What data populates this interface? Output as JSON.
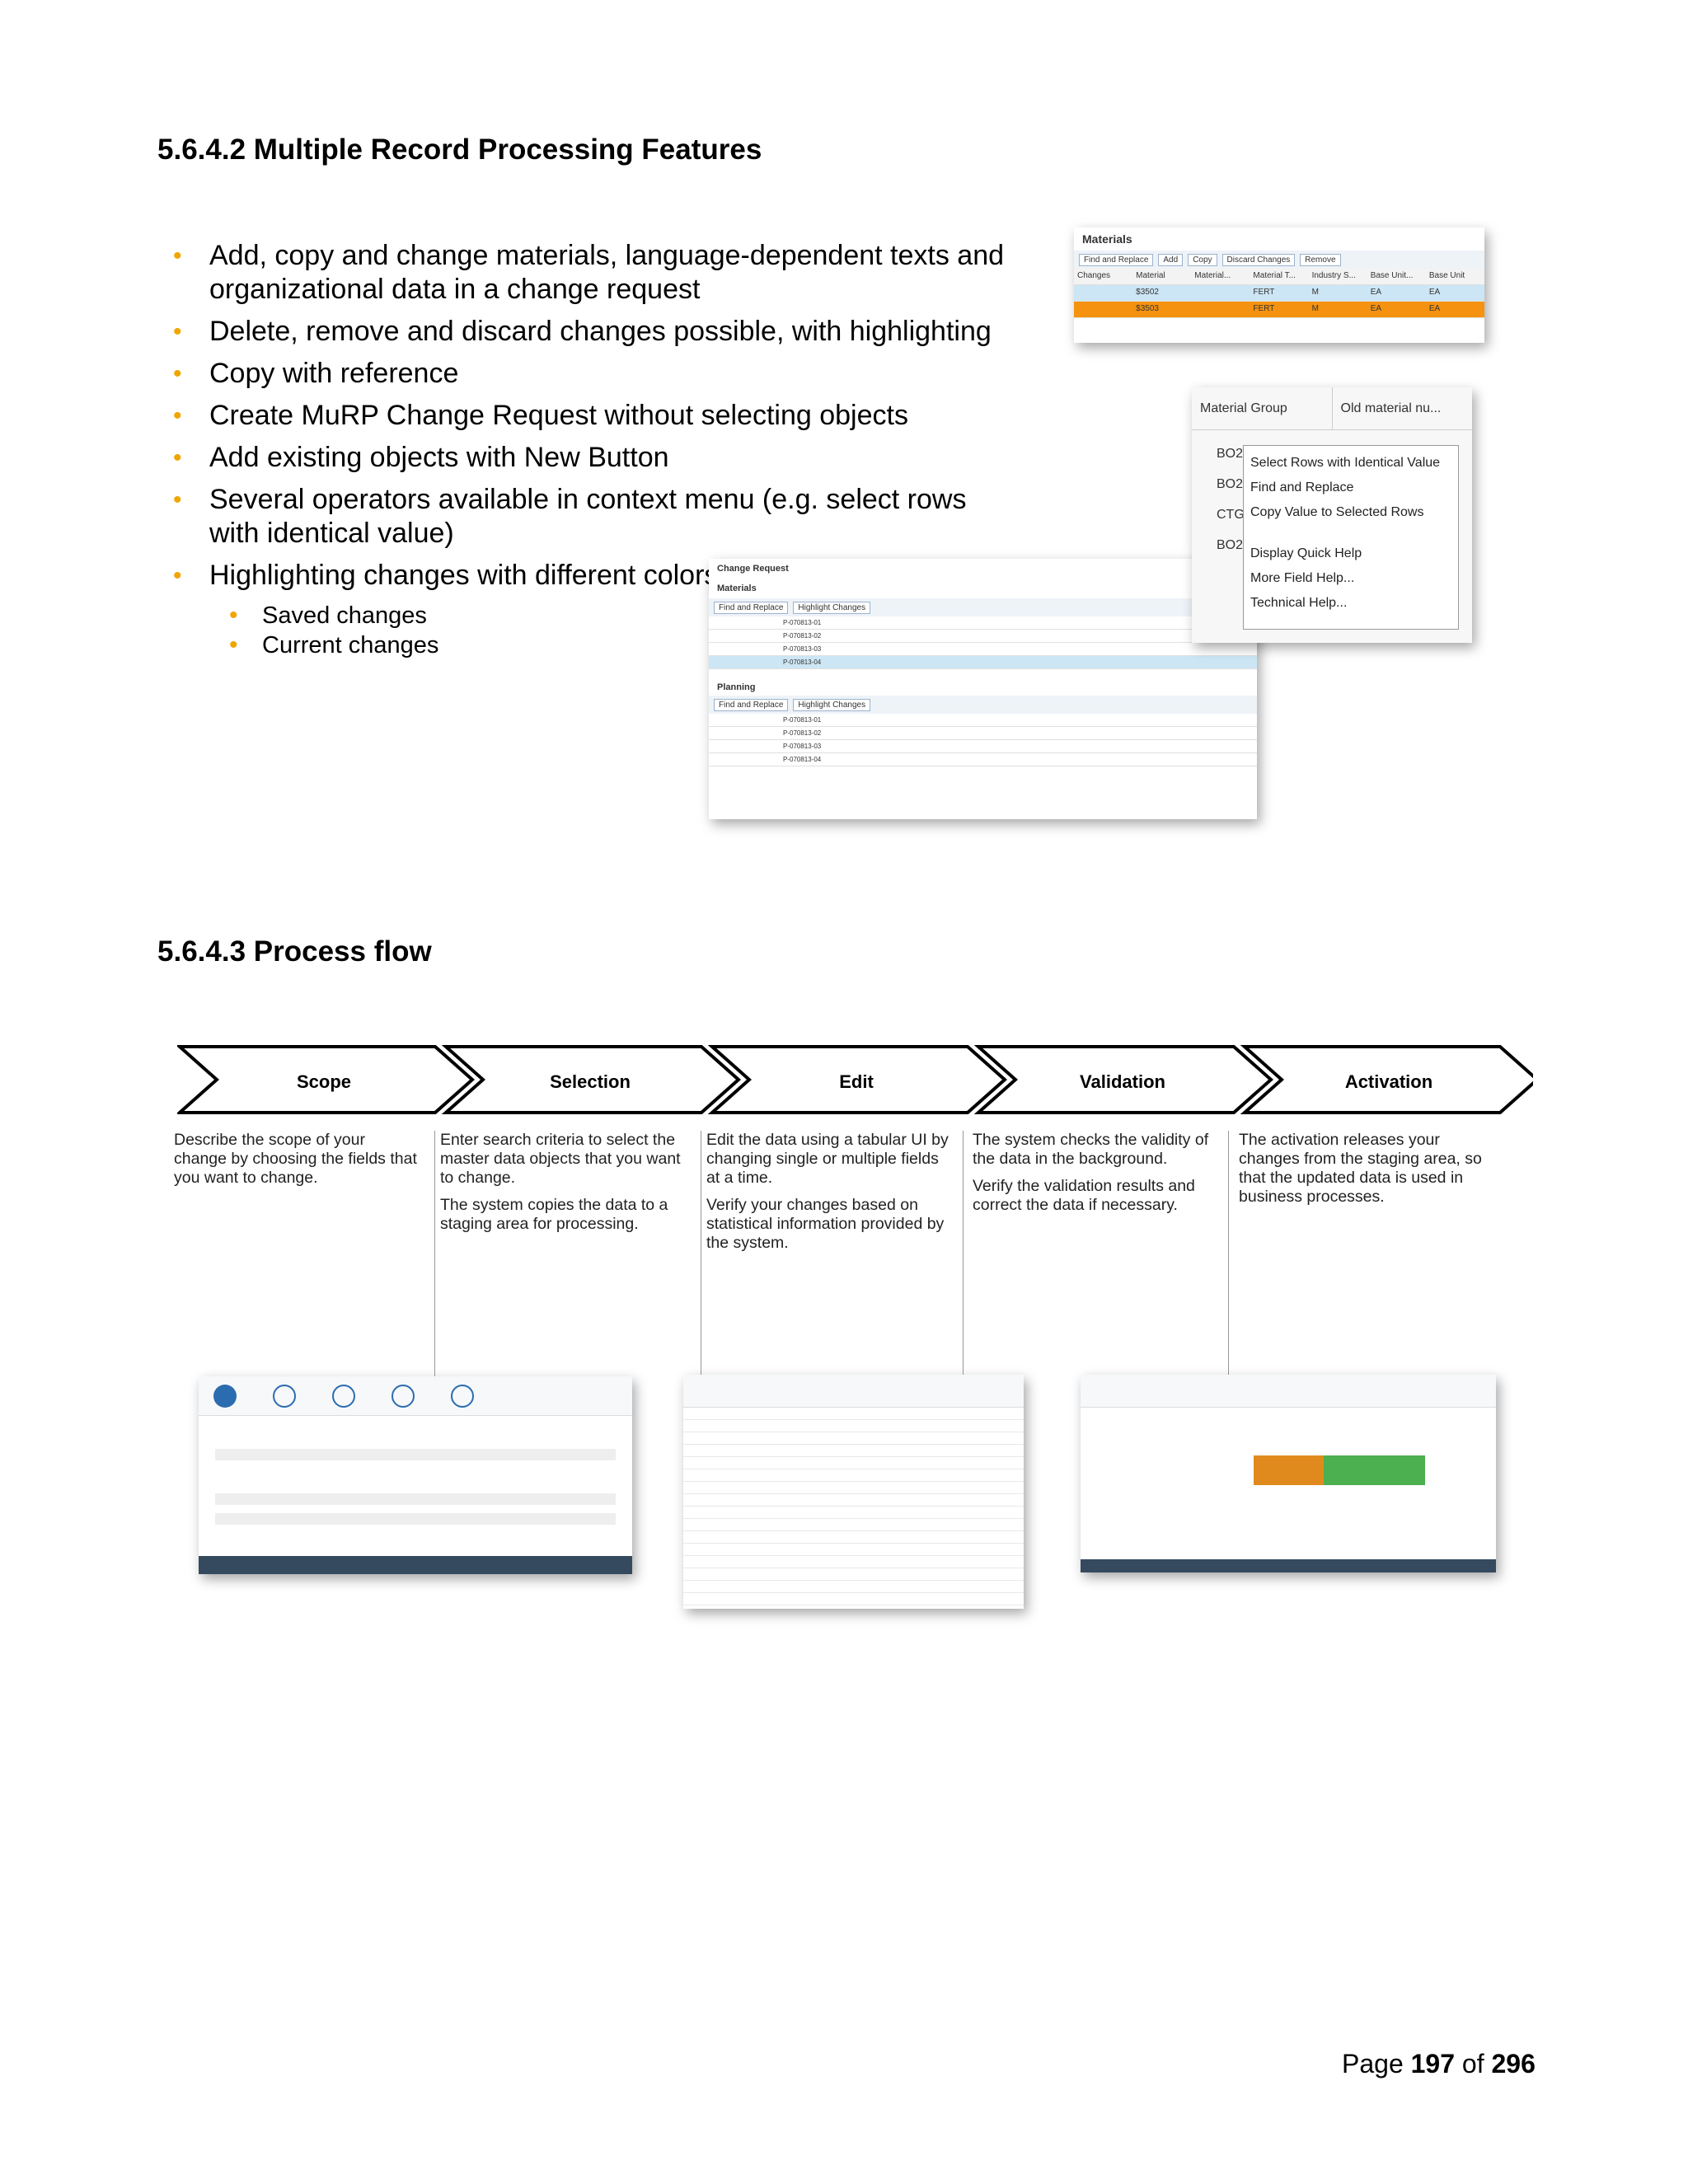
{
  "section1": {
    "heading": "5.6.4.2 Multiple Record Processing Features"
  },
  "bullets": [
    "Add, copy and change materials, language-dependent texts and organizational data in a change request",
    "Delete, remove and discard changes possible, with highlighting",
    "Copy with reference",
    "Create MuRP Change Request without selecting objects",
    "Add existing objects with New Button",
    "Several operators available in context menu (e.g. select rows with identical value)",
    "Highlighting changes with different colors"
  ],
  "sub_bullets": [
    "Saved changes",
    "Current changes"
  ],
  "shot1": {
    "title": "Materials",
    "toolbar": [
      "Find and Replace",
      "Add",
      "Copy",
      "Discard Changes",
      "Remove"
    ],
    "columns": [
      "Changes",
      "Material",
      "Material...",
      "Material T...",
      "Industry S...",
      "Base Unit...",
      "Base Unit"
    ],
    "rows": [
      [
        "",
        "$3502",
        "",
        "FERT",
        "M",
        "EA",
        "EA"
      ],
      [
        "",
        "$3503",
        "",
        "FERT",
        "M",
        "EA",
        "EA"
      ]
    ]
  },
  "shot2": {
    "columns": [
      "Material Group",
      "Old material nu..."
    ],
    "cells": [
      "BO2",
      "BO2",
      "CTG",
      "BO2"
    ],
    "menu": [
      "Select Rows with Identical Value",
      "Find and Replace",
      "Copy Value to Selected Rows",
      "Display Quick Help",
      "More Field Help...",
      "Technical Help..."
    ]
  },
  "shot3": {
    "title": "Change Request",
    "sec1": "Materials",
    "sec2": "Planning",
    "toolbar": [
      "Find and Replace",
      "Highlight Changes"
    ],
    "mat_rows": [
      "P-070813-01",
      "P-070813-02",
      "P-070813-03",
      "P-070813-04"
    ]
  },
  "section2": {
    "heading": "5.6.4.3 Process flow"
  },
  "steps": [
    {
      "label": "Scope",
      "desc": [
        "Describe the scope of your change by choosing the fields that you want to change."
      ]
    },
    {
      "label": "Selection",
      "desc": [
        "Enter search criteria to select the master data objects that you want to change.",
        "The system copies the data to a staging area for processing."
      ]
    },
    {
      "label": "Edit",
      "desc": [
        "Edit the data using a tabular UI by changing single or multiple fields at a time.",
        "Verify your changes based on statistical information provided by the system."
      ]
    },
    {
      "label": "Validation",
      "desc": [
        "The system checks the validity of the data in the background.",
        "Verify the validation results and correct the data if necessary."
      ]
    },
    {
      "label": "Activation",
      "desc": [
        "The activation releases your changes from the staging area, so that the updated data is used in business processes."
      ]
    }
  ],
  "page": {
    "prefix": "Page",
    "current": "197",
    "sep": "of",
    "total": "296"
  },
  "colors": {
    "bullet": "#f0a500",
    "highlight_orange": "#f5920f",
    "selected_blue": "#cde6f5",
    "sap_blue": "#2b6cb0"
  }
}
